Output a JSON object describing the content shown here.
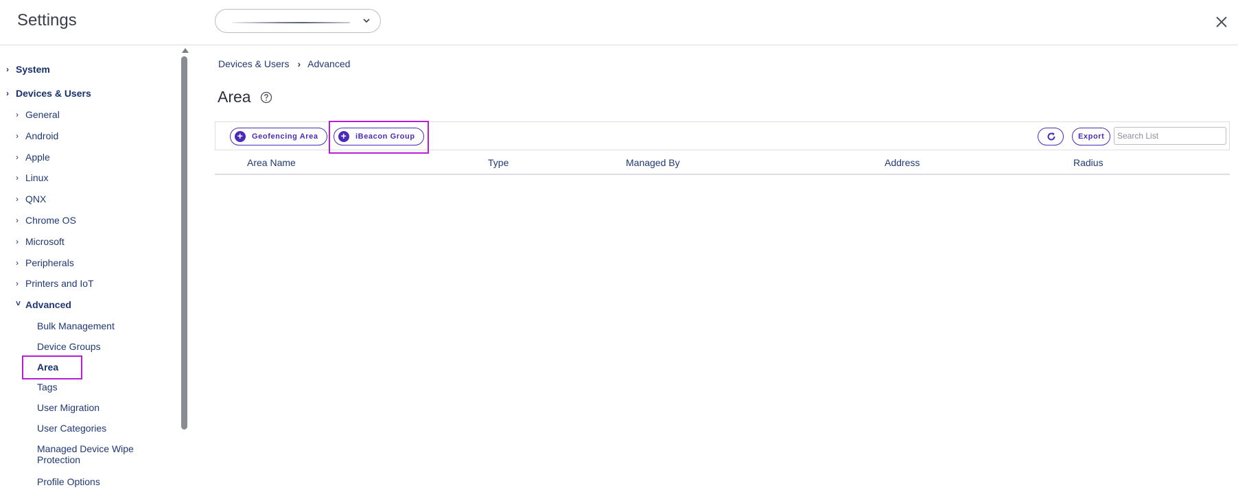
{
  "header": {
    "title": "Settings",
    "org_select_value": "",
    "close_icon": "close-icon"
  },
  "sidebar": {
    "top_sections": [
      {
        "label": "System",
        "expanded": false
      },
      {
        "label": "Devices & Users",
        "expanded": true
      }
    ],
    "platform_items": [
      {
        "label": "General"
      },
      {
        "label": "Android"
      },
      {
        "label": "Apple"
      },
      {
        "label": "Linux"
      },
      {
        "label": "QNX"
      },
      {
        "label": "Chrome OS"
      },
      {
        "label": "Microsoft"
      },
      {
        "label": "Peripherals"
      },
      {
        "label": "Printers and IoT"
      },
      {
        "label": "Advanced",
        "expanded": true
      }
    ],
    "advanced_items": [
      {
        "label": "Bulk Management"
      },
      {
        "label": "Device Groups"
      },
      {
        "label": "Area",
        "active": true
      },
      {
        "label": "Tags"
      },
      {
        "label": "User Migration"
      },
      {
        "label": "User Categories"
      },
      {
        "label": "Managed Device Wipe Protection"
      },
      {
        "label": "Profile Options"
      }
    ]
  },
  "main": {
    "breadcrumb": [
      "Devices & Users",
      "Advanced"
    ],
    "title": "Area",
    "toolbar": {
      "buttons": [
        {
          "label": "Geofencing Area",
          "icon": "plus-circle-icon"
        },
        {
          "label": "iBeacon Group",
          "icon": "plus-circle-icon"
        }
      ],
      "refresh_icon": "refresh-icon",
      "export_label": "Export",
      "search_placeholder": "Search List"
    },
    "table": {
      "columns": [
        "Area Name",
        "Type",
        "Managed By",
        "Address",
        "Radius"
      ],
      "rows": []
    }
  },
  "colors": {
    "accent": "#4a2bb8",
    "nav_text": "#1f3775",
    "highlight": "#b51ed6"
  }
}
